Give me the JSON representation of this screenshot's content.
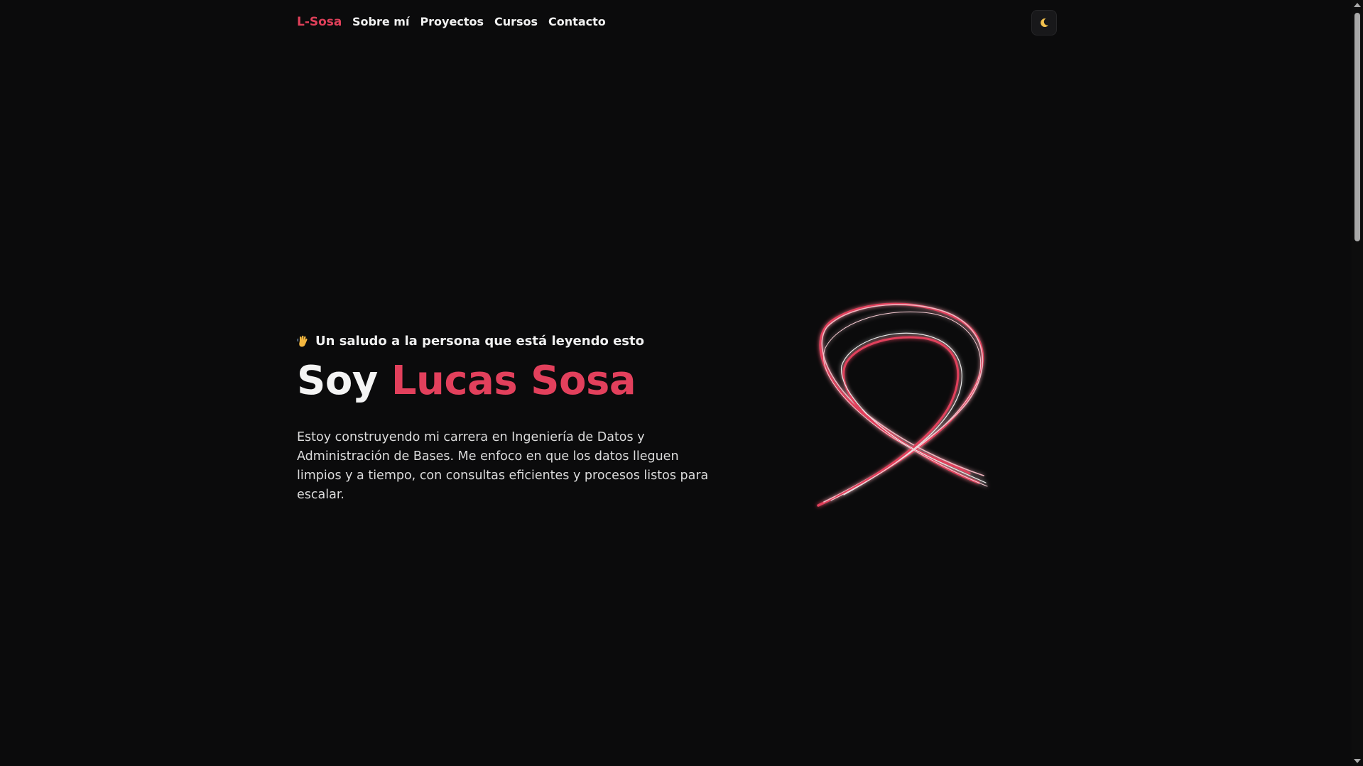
{
  "nav": {
    "brand": "L-Sosa",
    "links": [
      "Sobre mí",
      "Proyectos",
      "Cursos",
      "Contacto"
    ],
    "theme_toggle_icon": "moon-icon"
  },
  "hero": {
    "greeting_icon": "waving-hand-icon",
    "greeting": "Un saludo a la persona que está leyendo esto",
    "title_prefix": "Soy",
    "title_name": "Lucas Sosa",
    "description": "Estoy construyendo mi carrera en Ingeniería de Datos y Administración de Bases. Me enfoco en que los datos lleguen limpios y a tiempo, con consultas eficientes y procesos listos para escalar."
  },
  "decoration": {
    "ribbon_icon": "awareness-ribbon-icon"
  },
  "colors": {
    "background": "#0b0b0c",
    "accent": "#e2405c",
    "text": "#ececec"
  }
}
